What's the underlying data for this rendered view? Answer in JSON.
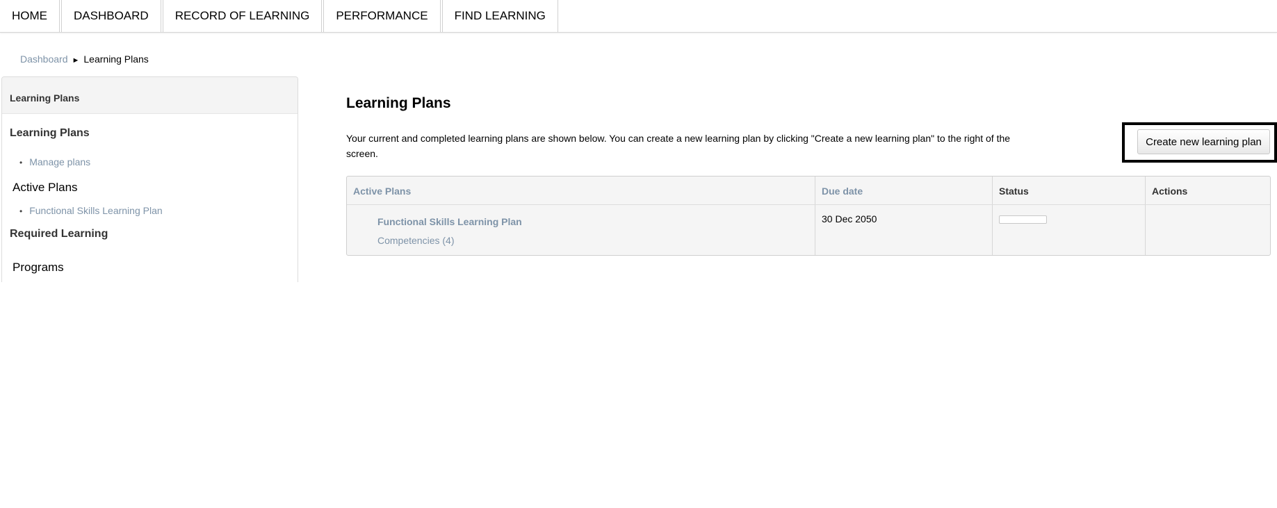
{
  "nav": {
    "tabs": [
      {
        "label": "HOME"
      },
      {
        "label": "DASHBOARD"
      },
      {
        "label": "RECORD OF LEARNING"
      },
      {
        "label": "PERFORMANCE"
      },
      {
        "label": "FIND LEARNING"
      }
    ]
  },
  "breadcrumb": {
    "parent": "Dashboard",
    "separator": "►",
    "current": "Learning Plans"
  },
  "sidebar": {
    "header": "Learning Plans",
    "section_learning_plans": "Learning Plans",
    "manage_plans": "Manage plans",
    "section_active_plans": "Active Plans",
    "active_plan_item": "Functional Skills Learning Plan",
    "section_required_learning": "Required Learning",
    "section_programs": "Programs"
  },
  "main": {
    "title": "Learning Plans",
    "intro": "Your current and completed learning plans are shown below. You can create a new learning plan by clicking \"Create a new learning plan\" to the right of the screen.",
    "create_button": "Create new learning plan"
  },
  "table": {
    "headers": {
      "active_plans": "Active Plans",
      "due_date": "Due date",
      "status": "Status",
      "actions": "Actions"
    },
    "rows": [
      {
        "plan": "Functional Skills Learning Plan",
        "competencies": "Competencies (4)",
        "due_date": "30 Dec 2050",
        "status_progress": 0,
        "actions": ""
      }
    ]
  },
  "colors": {
    "link": "#7e93a8",
    "highlight_border": "#000000"
  }
}
